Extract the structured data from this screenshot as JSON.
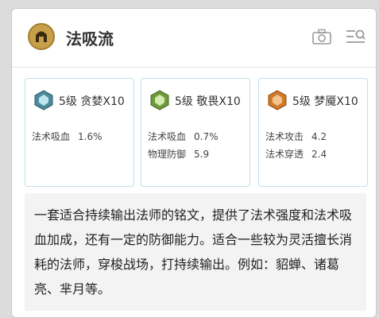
{
  "header": {
    "title": "法吸流"
  },
  "icons": {
    "logo": "helmet-emblem-icon",
    "camera": "camera-icon",
    "list": "search-list-icon"
  },
  "cards": [
    {
      "name": "5级 贪婪X10",
      "icon": "cyan-gem-icon",
      "color": "#4a8a9b",
      "stats": [
        {
          "label": "法术吸血",
          "value": "1.6%"
        }
      ]
    },
    {
      "name": "5级 敬畏X10",
      "icon": "green-gem-icon",
      "color": "#6e9a3a",
      "stats": [
        {
          "label": "法术吸血",
          "value": "0.7%"
        },
        {
          "label": "物理防御",
          "value": "5.9"
        }
      ]
    },
    {
      "name": "5级 梦魇X10",
      "icon": "orange-gem-icon",
      "color": "#d07a2a",
      "stats": [
        {
          "label": "法术攻击",
          "value": "4.2"
        },
        {
          "label": "法术穿透",
          "value": "2.4"
        }
      ]
    }
  ],
  "description": "一套适合持续输出法师的铭文，提供了法术强度和法术吸血加成，还有一定的防御能力。适合一些较为灵活擅长消耗的法师，穿梭战场，打持续输出。例如：貂蝉、诸葛亮、芈月等。"
}
